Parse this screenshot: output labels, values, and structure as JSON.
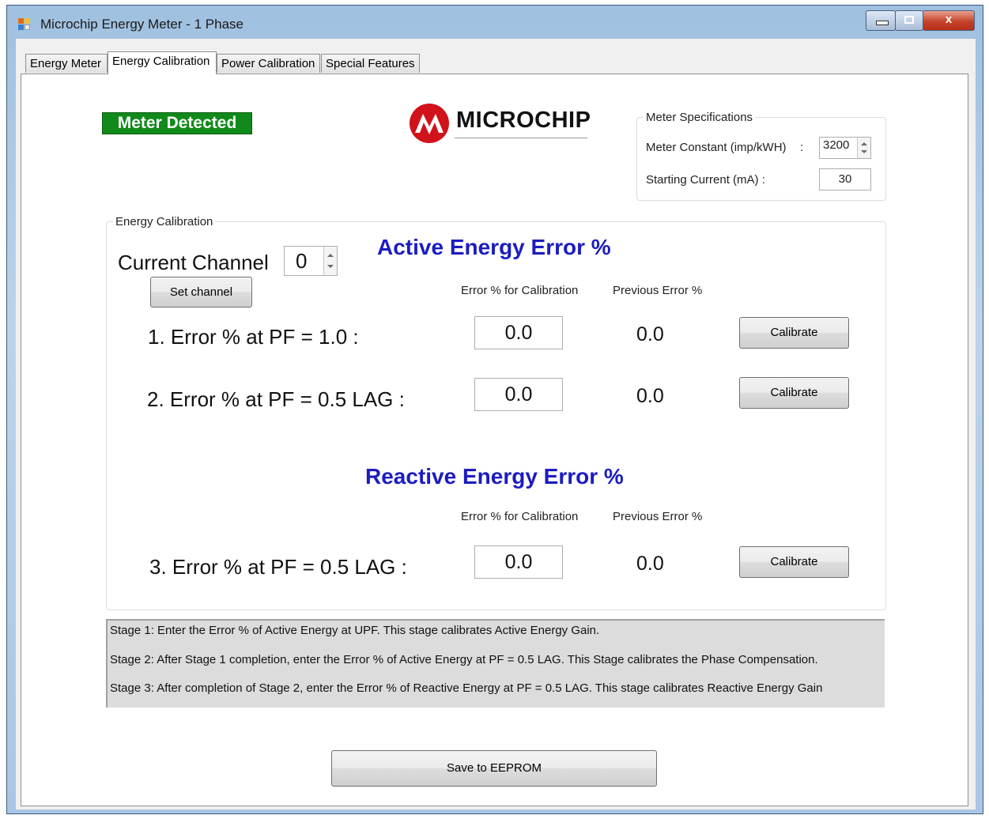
{
  "window": {
    "title": "Microchip Energy Meter - 1 Phase",
    "controls": {
      "minimize_icon": "minimize-icon",
      "maximize_icon": "maximize-icon",
      "close_glyph": "x"
    }
  },
  "tabs": [
    {
      "label": "Energy Meter",
      "active": false
    },
    {
      "label": "Energy Calibration",
      "active": true
    },
    {
      "label": "Power Calibration",
      "active": false
    },
    {
      "label": "Special Features",
      "active": false
    }
  ],
  "status_badge": {
    "text": "Meter Detected",
    "color": "#118a1b"
  },
  "logo": {
    "text": "MICROCHIP",
    "color": "#d1121a"
  },
  "meter_specifications": {
    "legend": "Meter Specifications",
    "meter_constant_label": "Meter Constant (imp/kWH)",
    "separator": ":",
    "meter_constant_value": "3200",
    "starting_current_label": "Starting Current (mA) :",
    "starting_current_value": "30"
  },
  "energy_calibration": {
    "legend": "Energy Calibration",
    "current_channel_label": "Current Channel",
    "current_channel_value": "0",
    "set_channel_button": "Set channel",
    "active": {
      "heading": "Active Energy Error %",
      "col_error": "Error % for Calibration",
      "col_previous": "Previous Error %",
      "rows": [
        {
          "label": "1. Error % at PF = 1.0 :",
          "error": "0.0",
          "previous": "0.0",
          "button": "Calibrate"
        },
        {
          "label": "2. Error % at PF = 0.5 LAG :",
          "error": "0.0",
          "previous": "0.0",
          "button": "Calibrate"
        }
      ]
    },
    "reactive": {
      "heading": "Reactive Energy Error %",
      "col_error": "Error % for Calibration",
      "col_previous": "Previous Error %",
      "rows": [
        {
          "label": "3. Error % at PF = 0.5 LAG :",
          "error": "0.0",
          "previous": "0.0",
          "button": "Calibrate"
        }
      ]
    }
  },
  "instructions": [
    "Stage 1: Enter the Error % of Active Energy at UPF. This stage calibrates Active Energy Gain.",
    "Stage 2: After Stage 1 completion, enter the Error % of Active Energy at PF = 0.5 LAG. This Stage calibrates the Phase Compensation.",
    "Stage 3: After completion of Stage 2, enter the Error % of Reactive Energy at PF = 0.5 LAG. This stage calibrates Reactive Energy Gain"
  ],
  "save_button": "Save to EEPROM"
}
